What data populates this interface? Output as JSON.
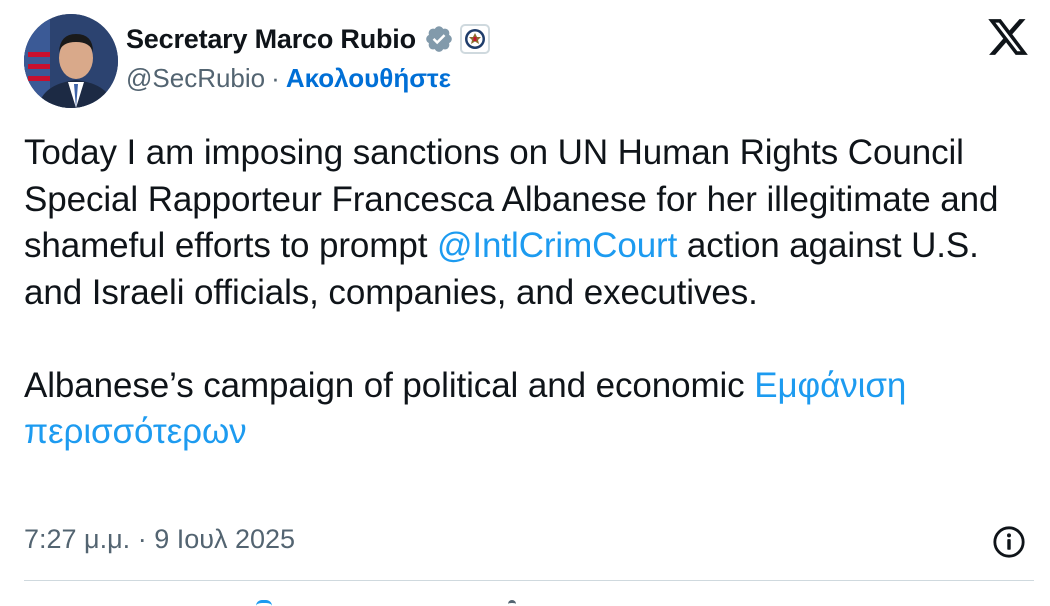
{
  "author": {
    "display_name": "Secretary Marco Rubio",
    "handle": "@SecRubio",
    "separator": "·",
    "follow_label": "Ακολουθήστε",
    "verified_icon": "verified-badge-gray",
    "affiliate_icon": "state-department-seal"
  },
  "brand": {
    "logo": "x-logo",
    "colors": {
      "link": "#1d9bf0",
      "follow": "#006fd6",
      "text": "#0f1419",
      "secondary": "#536471",
      "divider": "#cfd9de"
    }
  },
  "tweet": {
    "para1_pre": "Today I am imposing sanctions on UN Human Rights Council Special Rapporteur Francesca Albanese for her illegitimate and shameful efforts to prompt ",
    "mention": "@IntlCrimCourt",
    "para1_post": " action against U.S. and Israeli officials, companies, and executives.",
    "para2": "Albanese’s campaign of political and economic ",
    "show_more": "Εμφάνιση περισσότερων"
  },
  "footer": {
    "time": "7:27 μ.μ.",
    "separator": "·",
    "date": "9 Ιουλ 2025",
    "info_icon": "info-icon"
  }
}
